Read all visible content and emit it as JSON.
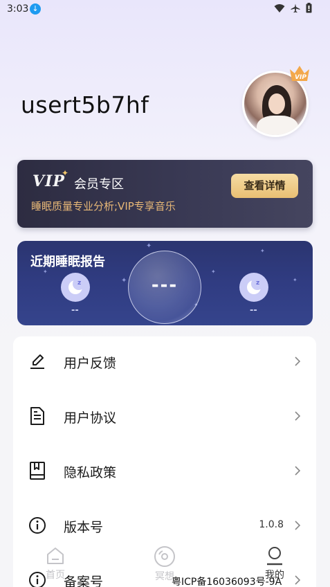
{
  "status_bar": {
    "time": "3:03"
  },
  "profile": {
    "username": "usert5b7hf",
    "vip_badge_text": "VIP"
  },
  "vip_card": {
    "logo": "VIP",
    "title": "会员专区",
    "subtitle": "睡眠质量专业分析;VIP专享音乐",
    "button": "查看详情",
    "colors": {
      "background": "#2d2c41",
      "accent_gold": "#e9bf73",
      "subtitle": "#e8b877"
    }
  },
  "sleep_report": {
    "title": "近期睡眠报告",
    "score": "---",
    "left_value": "--",
    "right_value": "--",
    "colors": {
      "background": "#303c82"
    }
  },
  "menu": {
    "items": [
      {
        "label": "用户反馈",
        "icon": "edit-pen-icon",
        "value": ""
      },
      {
        "label": "用户协议",
        "icon": "document-icon",
        "value": ""
      },
      {
        "label": "隐私政策",
        "icon": "book-icon",
        "value": ""
      },
      {
        "label": "版本号",
        "icon": "info-icon",
        "value": "1.0.8"
      },
      {
        "label": "备案号",
        "icon": "info-icon",
        "value": ""
      }
    ]
  },
  "bottom_nav": {
    "items": [
      {
        "label": "首页",
        "icon": "home-icon",
        "active": false
      },
      {
        "label": "冥想",
        "icon": "disc-icon",
        "active": false
      },
      {
        "label": "我的",
        "icon": "user-icon",
        "active": true
      }
    ]
  },
  "icp_text": "粤ICP备16036093号-9A"
}
